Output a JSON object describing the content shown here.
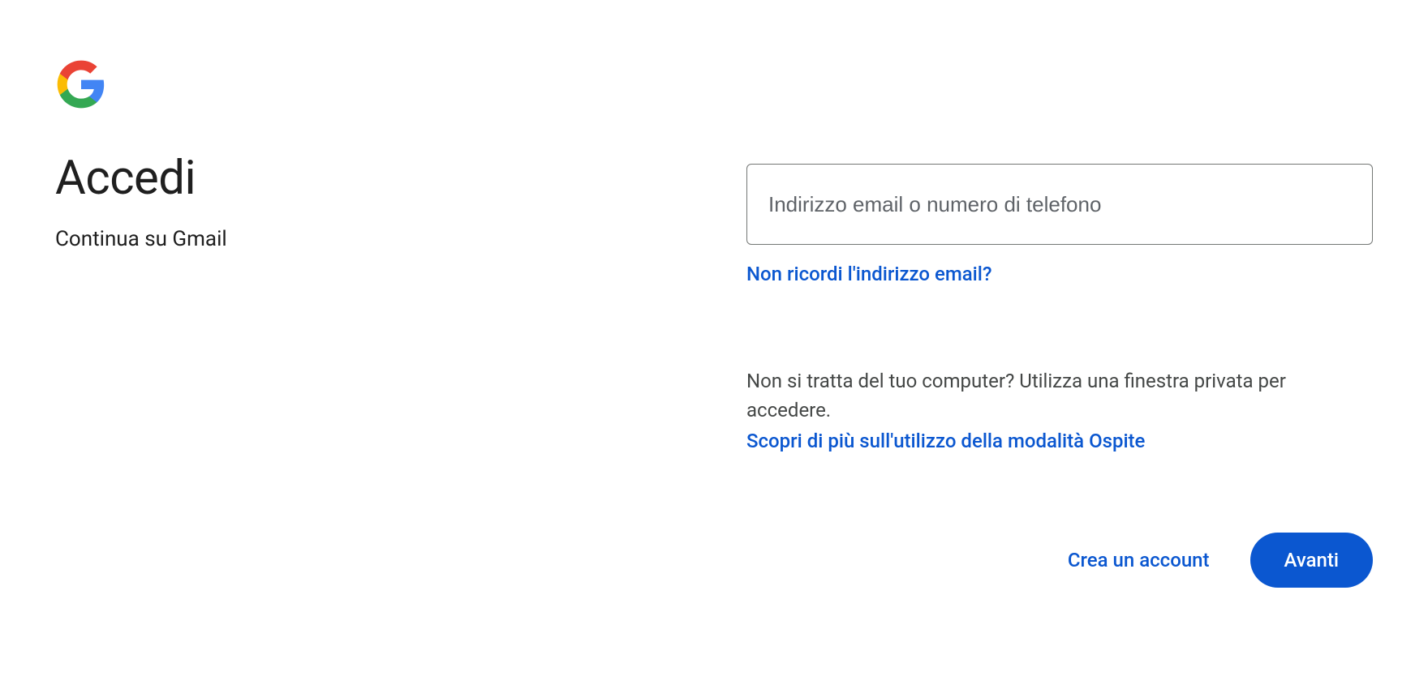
{
  "title": "Accedi",
  "subtitle": "Continua su Gmail",
  "email_placeholder": "Indirizzo email o numero di telefono",
  "forgot_email": "Non ricordi l'indirizzo email?",
  "guest_text": "Non si tratta del tuo computer? Utilizza una finestra privata per accedere.",
  "guest_link": "Scopri di più sull'utilizzo della modalità Ospite",
  "create_account": "Crea un account",
  "next_button": "Avanti"
}
